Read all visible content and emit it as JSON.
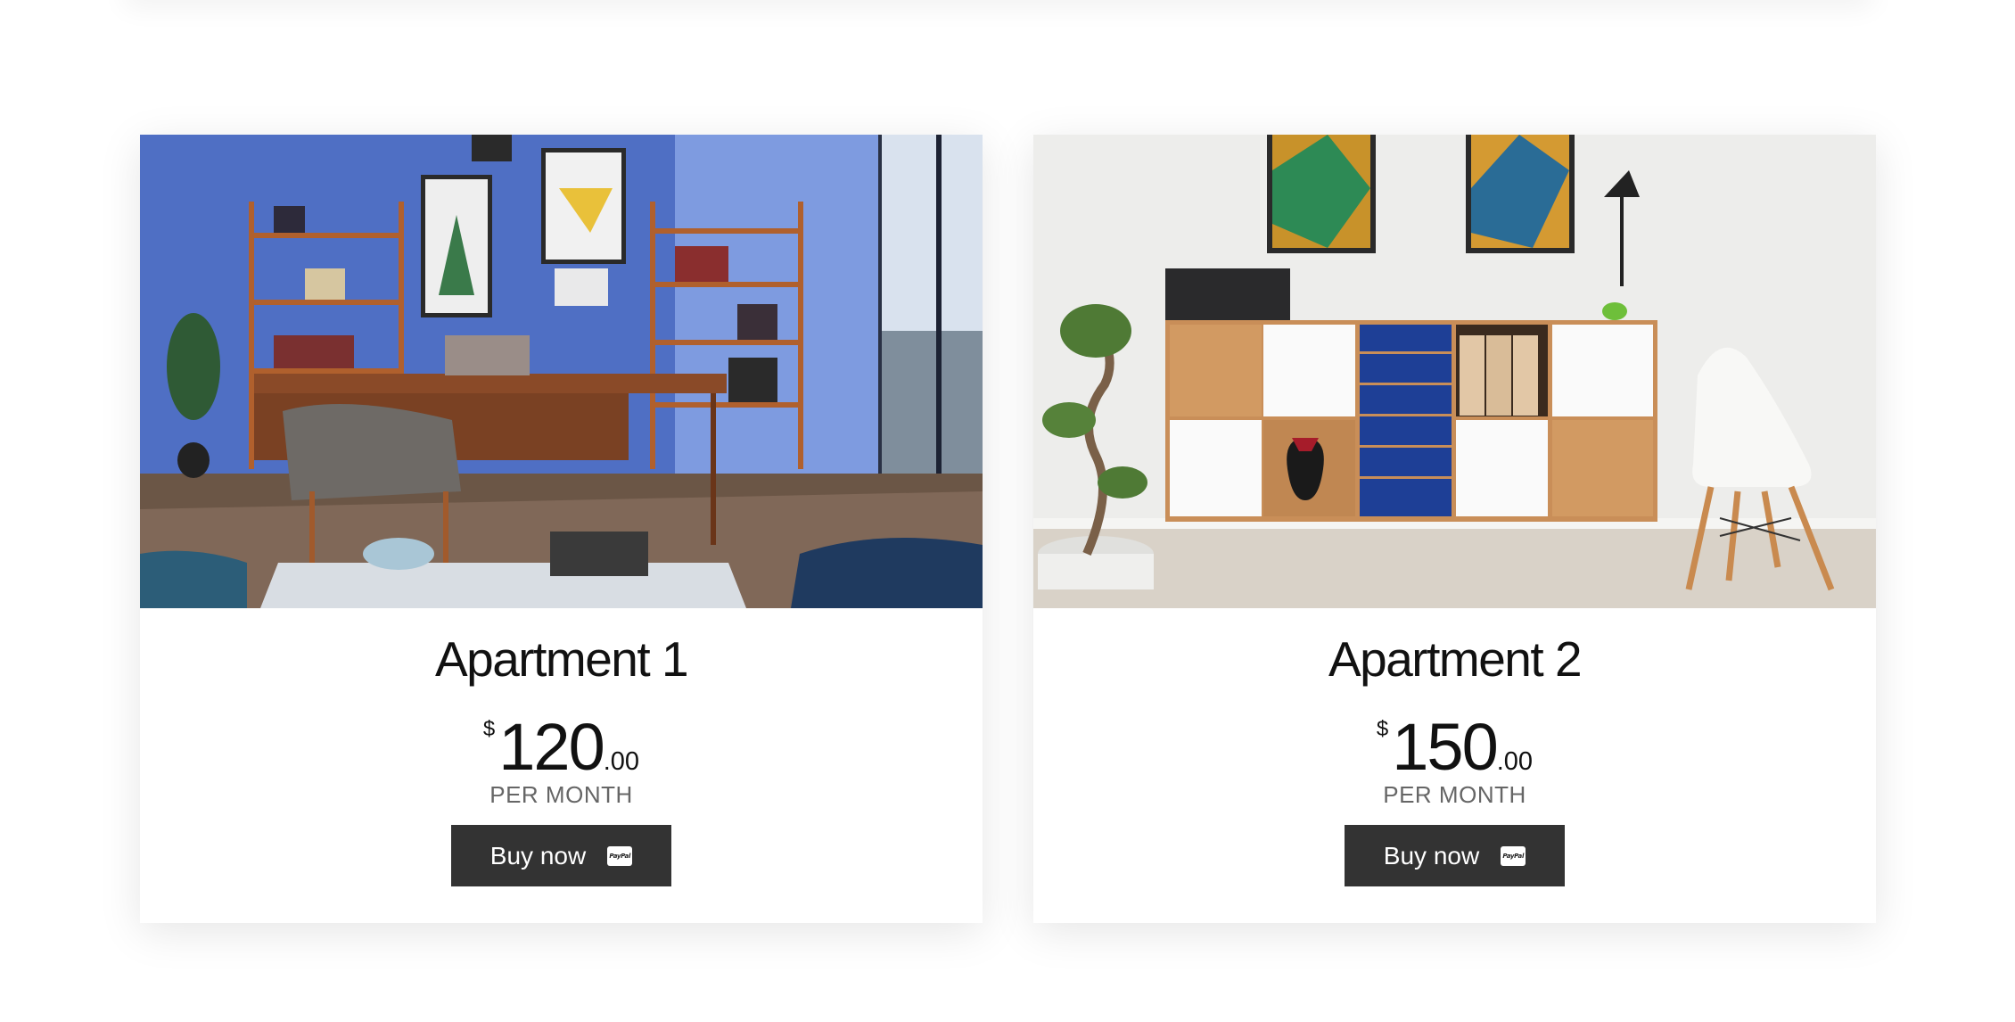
{
  "listings": [
    {
      "title": "Apartment 1",
      "currency": "$",
      "price_whole": "120",
      "price_cents": ".00",
      "period": "PER MONTH",
      "button_label": "Buy now",
      "button_icon": "paypal-icon",
      "paypal_text": "PayPal"
    },
    {
      "title": "Apartment 2",
      "currency": "$",
      "price_whole": "150",
      "price_cents": ".00",
      "period": "PER MONTH",
      "button_label": "Buy now",
      "button_icon": "paypal-icon",
      "paypal_text": "PayPal"
    }
  ],
  "colors": {
    "button_bg": "#333333",
    "period_text": "#666666",
    "card_bg": "#ffffff"
  }
}
